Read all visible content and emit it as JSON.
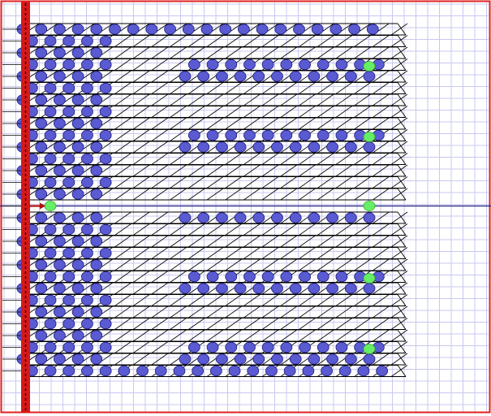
{
  "colors": {
    "background": "#ffffff",
    "grid": "#c8c8f0",
    "frame": "#e02020",
    "wall": "#d81818",
    "wall_dash": "#000000",
    "stroke": "#000000",
    "blue_node": "#5a5ad2",
    "blue_node_stroke": "#1e1e78",
    "green_node": "#66ee66",
    "green_node_stroke": "#33aa33",
    "center_line": "#1a1a7a",
    "arrow": "#b01010"
  },
  "diagram": {
    "row_count": 30,
    "marker_row": 15,
    "column_count": 20,
    "blue_left_columns": 5,
    "blue_band_columns": 11,
    "band_start_rows": [
      3,
      9,
      15,
      21,
      27
    ],
    "band_rows_per_group": 2,
    "green_marker_rows": [
      3,
      9,
      15,
      21,
      27
    ],
    "bottom_full_rows": 1
  }
}
